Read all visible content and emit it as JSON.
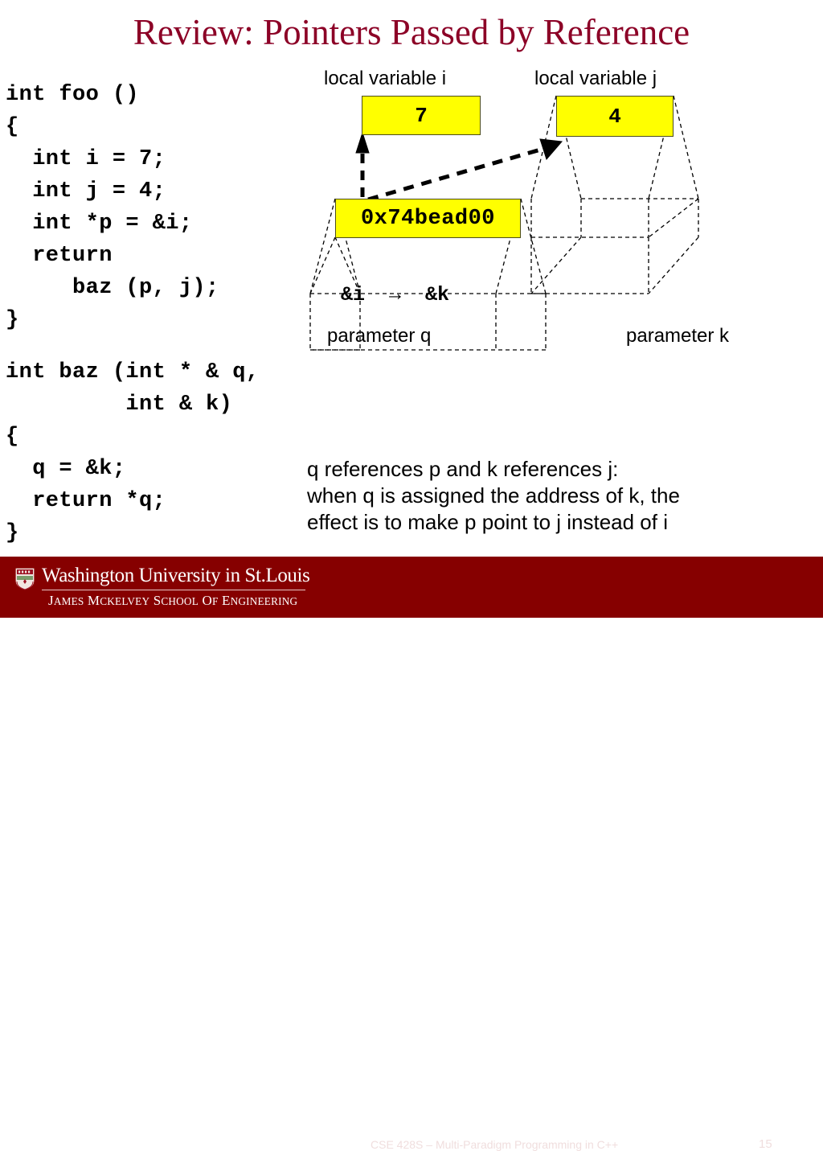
{
  "slide": {
    "title": "Review: Pointers Passed by Reference",
    "page_number": "15",
    "accent_color": "#8C0026",
    "footer_color": "#860000",
    "highlight_color": "#FFFF00"
  },
  "code": {
    "foo": "int foo ()\n{\n  int i = 7;\n  int j = 4;\n  int *p = &i;\n  return\n     baz (p, j);\n}",
    "baz": "int baz (int * & q,\n         int & k)\n{\n  q = &k;\n  return *q;\n}"
  },
  "diagram": {
    "label_local_i": "local variable i",
    "label_local_j": "local variable j",
    "label_param_q": "parameter q",
    "label_param_k": "parameter k",
    "value_i": "7",
    "value_j": "4",
    "value_p": "0x74bead00",
    "face_q_text": "&i  →  &k",
    "face_k_text": ""
  },
  "explanation": {
    "line1": "q references p and k references j:",
    "line2": "when q is assigned the address of k, the",
    "line3": "effect is to make p point to j instead of i"
  },
  "footer": {
    "university": "Washington University in St.Louis",
    "school": "James McKelvey School of Engineering",
    "course": "CSE 428S – Multi-Paradigm Programming in C++",
    "page": "15"
  }
}
